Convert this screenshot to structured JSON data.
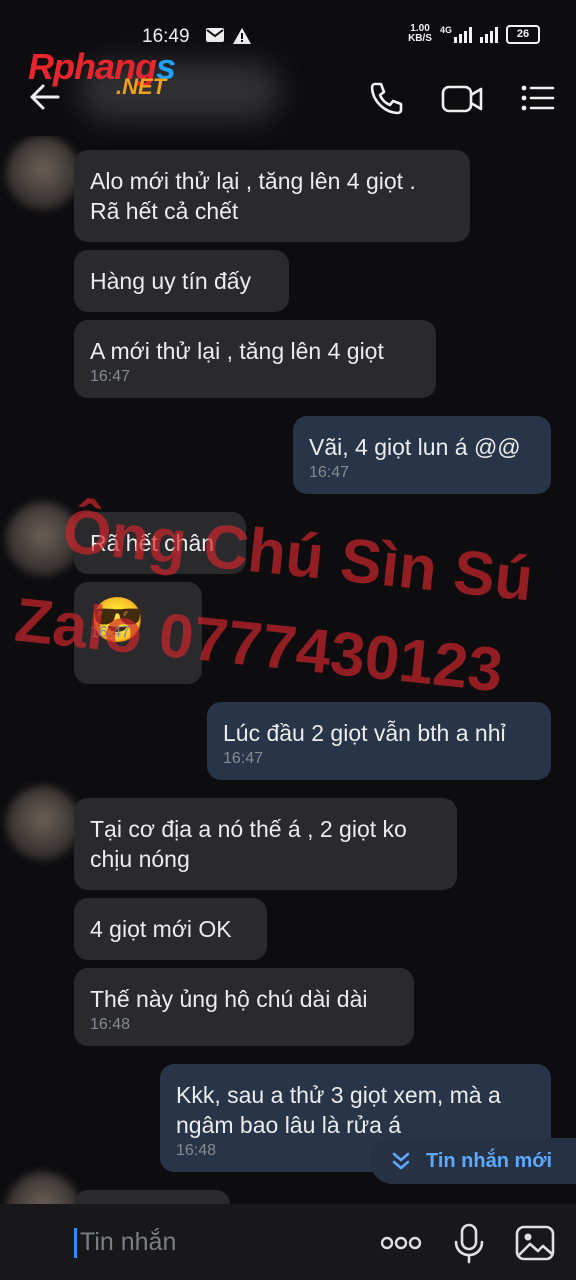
{
  "status_bar": {
    "time": "16:49",
    "net_speed_value": "1.00",
    "net_speed_unit": "KB/S",
    "network": "4G",
    "battery": "26"
  },
  "logo": {
    "main": "Rphang",
    "tail": "s",
    "suffix": ".NET"
  },
  "header": {
    "contact_name_hidden": true
  },
  "messages": [
    {
      "side": "in",
      "text": "Alo mới thử lại , tăng lên 4 giọt .\nRã hết cả chết",
      "time": ""
    },
    {
      "side": "in",
      "text": "Hàng uy tín đấy",
      "time": ""
    },
    {
      "side": "in",
      "text": "A mới thử lại , tăng lên 4 giọt",
      "time": "16:47"
    },
    {
      "side": "out",
      "text": "Vãi, 4 giọt lun á @@",
      "time": "16:47"
    },
    {
      "side": "in",
      "text": "Rã hết chân",
      "time": ""
    },
    {
      "side": "in",
      "text": "😎",
      "time": "16:47"
    },
    {
      "side": "out",
      "text": "Lúc đầu 2 giọt vẫn bth a nhỉ",
      "time": "16:47"
    },
    {
      "side": "in",
      "text": "Tại cơ địa a nó thế á , 2 giọt ko\nchịu nóng",
      "time": ""
    },
    {
      "side": "in",
      "text": "4 giọt mới OK",
      "time": ""
    },
    {
      "side": "in",
      "text": "Thế này ủng hộ chú dài dài",
      "time": "16:48"
    },
    {
      "side": "out",
      "text": "Kkk, sau a thử 3 giọt xem, mà a\nngâm bao lâu là rửa á",
      "time": "16:48"
    }
  ],
  "watermark": {
    "line1": "Ông Chú Sìn Sú",
    "line2": "Zalo 0777430123"
  },
  "new_message_label": "Tin nhắn mới",
  "input": {
    "placeholder": "Tin nhắn"
  },
  "colors": {
    "background": "#0d0d0f",
    "incoming_bubble": "#2a2a2d",
    "outgoing_bubble": "#283447",
    "accent": "#2e8cff",
    "watermark": "#d2262d"
  },
  "icons": [
    "back-arrow-icon",
    "phone-icon",
    "video-call-icon",
    "menu-icon",
    "mail-icon",
    "warning-icon",
    "signal-icon",
    "chevron-down-icon",
    "more-icon",
    "microphone-icon",
    "image-icon"
  ]
}
